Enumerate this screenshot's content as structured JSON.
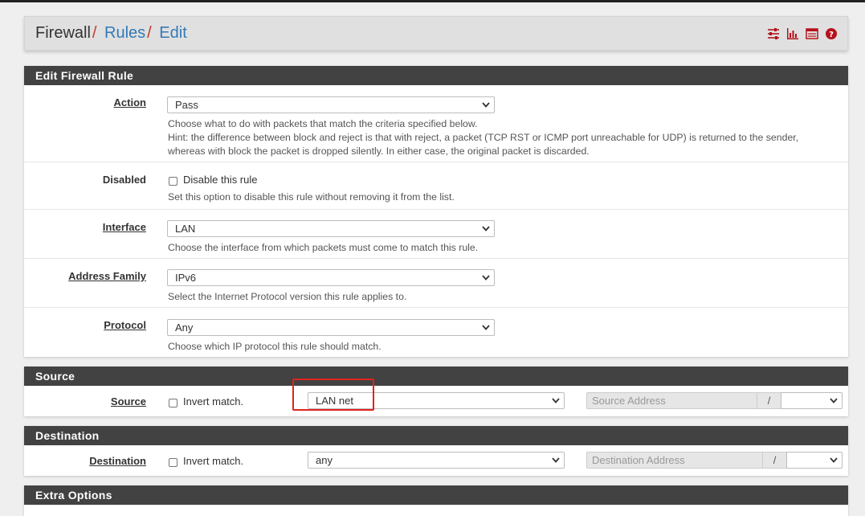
{
  "breadcrumb": {
    "items": [
      "Firewall",
      "Rules",
      "Edit"
    ],
    "separator": "/"
  },
  "header_icons": [
    "sliders-icon",
    "bar-chart-icon",
    "list-table-icon",
    "help-circle-icon"
  ],
  "edit_panel": {
    "title": "Edit Firewall Rule",
    "action": {
      "label": "Action",
      "value": "Pass",
      "help1": "Choose what to do with packets that match the criteria specified below.",
      "help2": "Hint: the difference between block and reject is that with reject, a packet (TCP RST or ICMP port unreachable for UDP) is returned to the sender,",
      "help3": "whereas with block the packet is dropped silently. In either case, the original packet is discarded."
    },
    "disabled": {
      "label": "Disabled",
      "checkbox_label": "Disable this rule",
      "help": "Set this option to disable this rule without removing it from the list."
    },
    "interface": {
      "label": "Interface",
      "value": "LAN",
      "help": "Choose the interface from which packets must come to match this rule."
    },
    "address_family": {
      "label": "Address Family",
      "value": "IPv6",
      "help": "Select the Internet Protocol version this rule applies to."
    },
    "protocol": {
      "label": "Protocol",
      "value": "Any",
      "help": "Choose which IP protocol this rule should match."
    }
  },
  "source_panel": {
    "title": "Source",
    "label": "Source",
    "invert_label": "Invert match.",
    "type_value": "LAN net",
    "address_placeholder": "Source Address",
    "slash": "/"
  },
  "destination_panel": {
    "title": "Destination",
    "label": "Destination",
    "invert_label": "Invert match.",
    "type_value": "any",
    "address_placeholder": "Destination Address",
    "slash": "/"
  },
  "extra_panel": {
    "title": "Extra Options"
  },
  "colors": {
    "accent": "#337ab7",
    "panel_heading": "#424242",
    "breadcrumb_separator": "#c0392b",
    "icon_red": "#b5121b",
    "highlight_box": "#e0231c"
  }
}
